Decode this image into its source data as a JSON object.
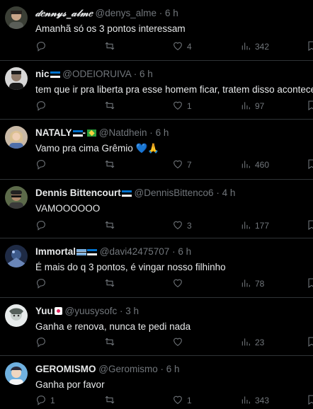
{
  "tweets": [
    {
      "name": "𝒹𝑒𝓃𝓃𝓎𝓈_𝒶𝓁𝓂𝑒",
      "handle": "@denys_alme",
      "time": "6 h",
      "text": "Amanhã só os 3 pontos interessam",
      "replies": "",
      "retweets": "",
      "likes": "4",
      "views": "342"
    },
    {
      "name": "nic",
      "handle": "@ODEIORUIVA",
      "time": "6 h",
      "text": "tem que ir pra liberta pra esse homem ficar, tratem disso acontecer",
      "replies": "",
      "retweets": "",
      "likes": "1",
      "views": "97"
    },
    {
      "name": "NATALY",
      "handle": "@Natdhein",
      "time": "6 h",
      "text": "Vamo pra cima Grêmio 💙🙏",
      "replies": "",
      "retweets": "",
      "likes": "7",
      "views": "460"
    },
    {
      "name": "Dennis Bittencourt",
      "handle": "@DennisBittenco6",
      "time": "4 h",
      "text": "VAMOOOOOO",
      "replies": "",
      "retweets": "",
      "likes": "3",
      "views": "177"
    },
    {
      "name": "Immortal",
      "handle": "@davi42475707",
      "time": "6 h",
      "text": "É mais do q 3 pontos, é vingar nosso filhinho",
      "replies": "",
      "retweets": "",
      "likes": "",
      "views": "78"
    },
    {
      "name": "Yuu",
      "handle": "@yuusysofc",
      "time": "3 h",
      "text": "Ganha e renova, nunca te pedi nada",
      "replies": "",
      "retweets": "",
      "likes": "",
      "views": "23"
    },
    {
      "name": "GEROMISMO",
      "handle": "@Geromismo",
      "time": "6 h",
      "text": "Ganha por favor",
      "replies": "1",
      "retweets": "",
      "likes": "1",
      "views": "343"
    }
  ],
  "separator": "·",
  "icons": {
    "reply": "reply-icon",
    "retweet": "retweet-icon",
    "like": "heart-icon",
    "views": "views-icon",
    "bookmark": "bookmark-icon"
  },
  "colors": {
    "background": "#000000",
    "text": "#e7e9ea",
    "muted": "#71767b",
    "divider": "#2f3336"
  }
}
